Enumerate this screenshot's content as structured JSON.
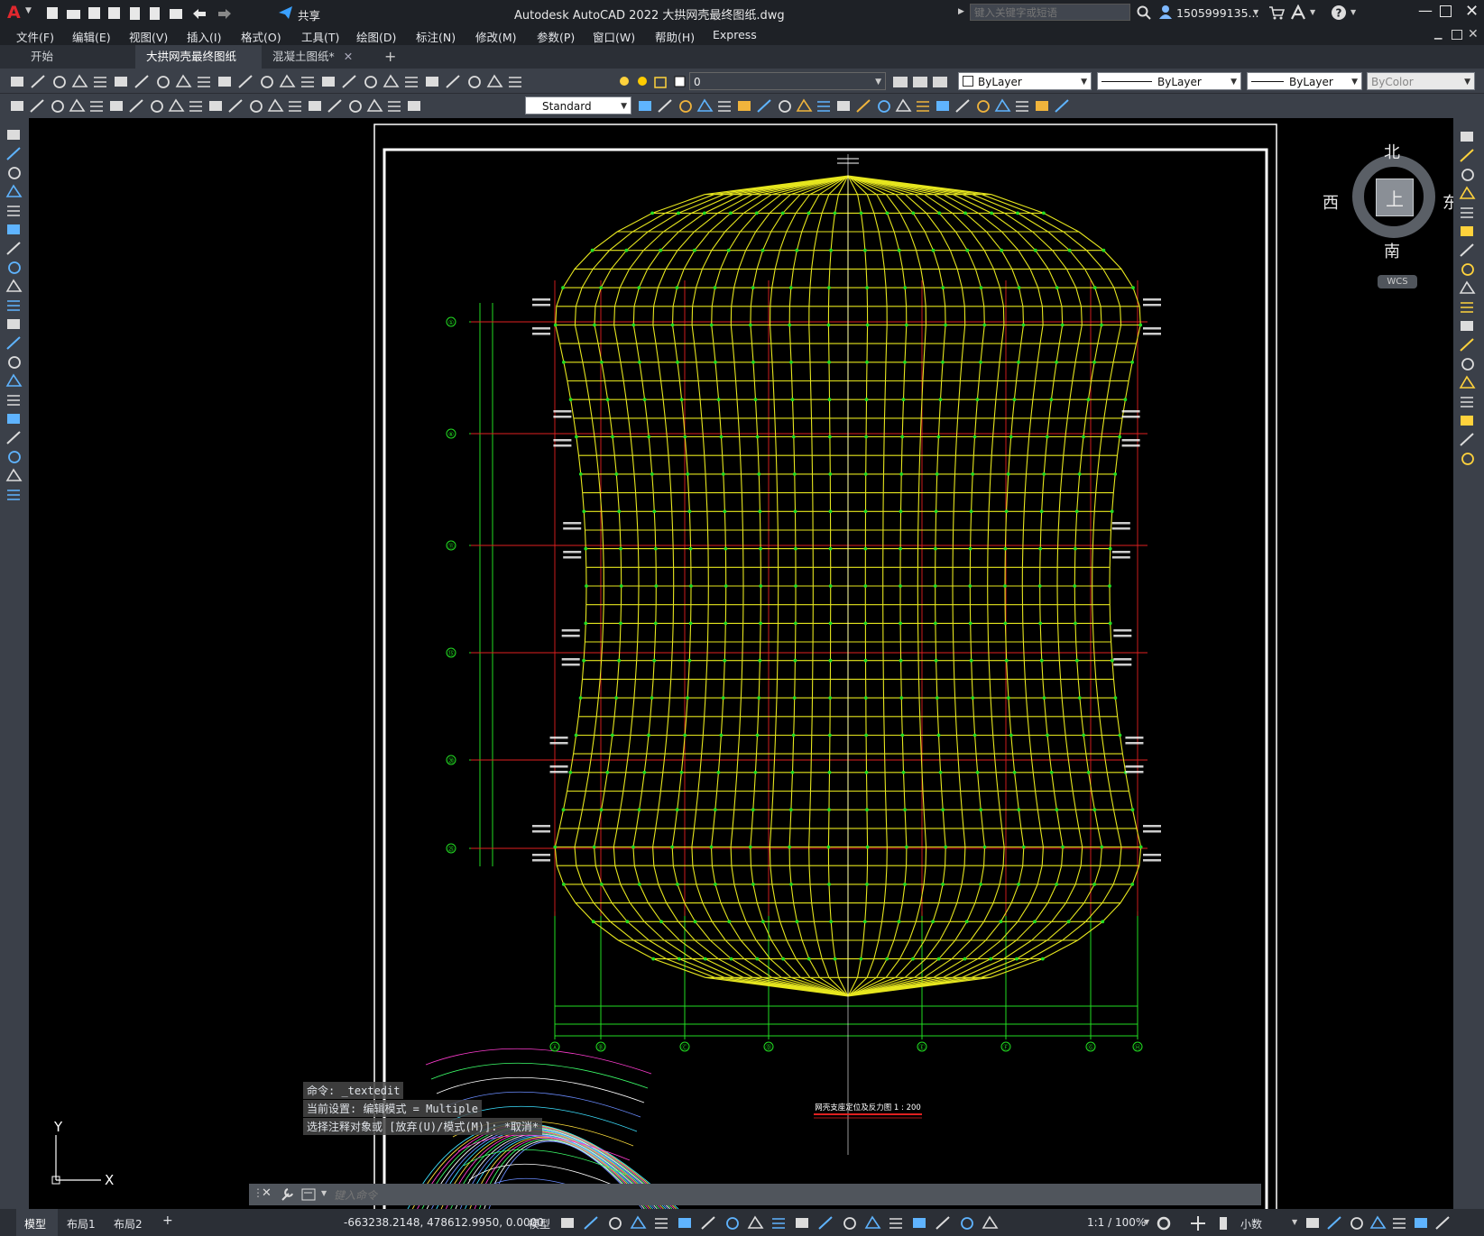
{
  "titlebar": {
    "app_logo": "A",
    "share_label": "共享",
    "title": "Autodesk AutoCAD 2022    大拱网壳最终图纸.dwg",
    "search_placeholder": "键入关键字或短语",
    "user": "1505999135...",
    "window_controls": [
      "minimize-icon",
      "maximize-icon",
      "close-icon"
    ]
  },
  "menu": {
    "items": [
      "文件(F)",
      "编辑(E)",
      "视图(V)",
      "插入(I)",
      "格式(O)",
      "工具(T)",
      "绘图(D)",
      "标注(N)",
      "修改(M)",
      "参数(P)",
      "窗口(W)",
      "帮助(H)",
      "Express"
    ]
  },
  "tabs": {
    "items": [
      {
        "label": "开始",
        "active": false,
        "closable": false
      },
      {
        "label": "大拱网壳最终图纸*",
        "active": true,
        "closable": true
      },
      {
        "label": "混凝土图纸*",
        "active": false,
        "closable": true
      }
    ],
    "add_label": "+"
  },
  "toolbar": {
    "layer_value": "0",
    "color_value": "ByLayer",
    "linetype_value": "ByLayer",
    "lineweight_value": "ByLayer",
    "plotstyle_value": "ByColor",
    "textstyle_value": "Standard"
  },
  "viewcube": {
    "north": "北",
    "south": "南",
    "east": "东",
    "west": "西",
    "face": "上",
    "wcs_label": "WCS"
  },
  "ucs": {
    "x_label": "X",
    "y_label": "Y"
  },
  "drawing": {
    "caption": "网壳支座定位及反力图 1 : 200",
    "grid_left_labels": [
      "①",
      "⑥",
      "⑪",
      "⑮",
      "⑳",
      "㉕"
    ],
    "grid_bottom_labels": [
      "Ⓐ",
      "Ⓑ",
      "Ⓒ",
      "Ⓓ",
      "Ⓔ",
      "Ⓕ",
      "Ⓖ",
      "Ⓗ"
    ]
  },
  "command": {
    "history": [
      "命令:  _textedit",
      "当前设置: 编辑模式 = Multiple",
      "选择注释对象或 [放弃(U)/模式(M)]: *取消*"
    ],
    "input_placeholder": "键入命令"
  },
  "status": {
    "layout_tabs": [
      "模型",
      "布局1",
      "布局2"
    ],
    "add_label": "+",
    "coordinates": "-663238.2148, 478612.9950, 0.0000",
    "mode_label": "模型",
    "scale_label": "1:1 / 100%",
    "units_label": "小数"
  },
  "colors": {
    "mesh": "#e6e61e",
    "nodes": "#22dd22",
    "axis_red": "#e02020",
    "dims_green": "#22dd22",
    "frame": "#ffffff"
  }
}
